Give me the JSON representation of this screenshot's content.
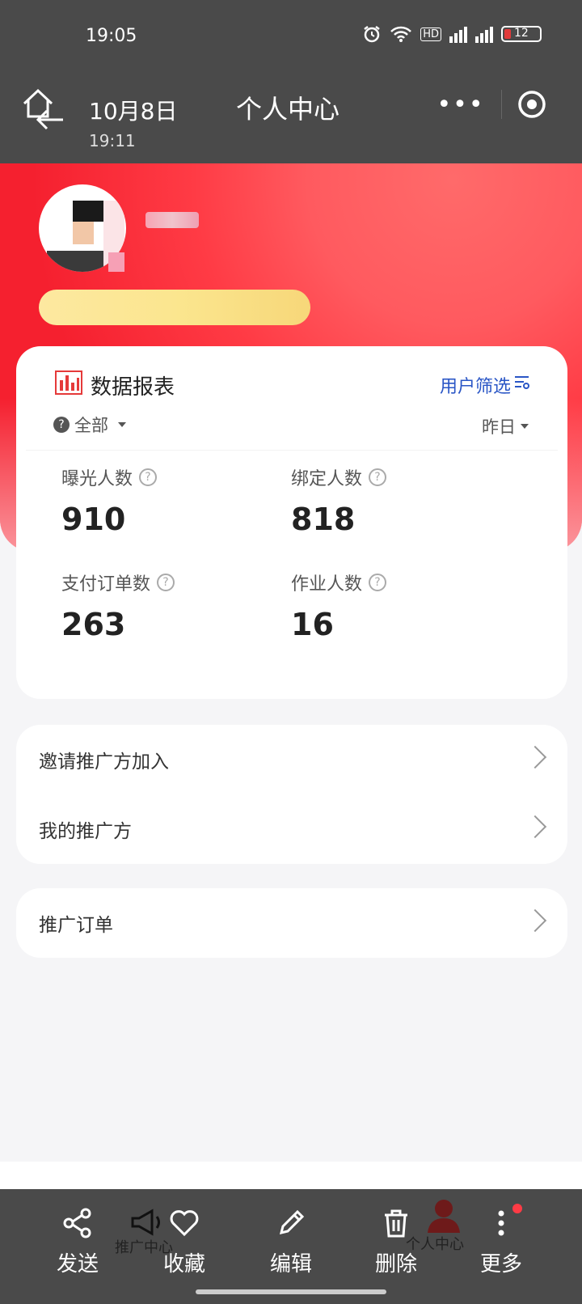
{
  "status_bar": {
    "time": "19:05",
    "network": "4G",
    "hd": "HD",
    "battery": "12"
  },
  "nav": {
    "date": "10月8日",
    "time": "19:11",
    "title": "个人中心",
    "more": "•••"
  },
  "data_card": {
    "title": "数据报表",
    "filter_label": "用户筛选",
    "scope": "全部",
    "period": "昨日",
    "stats": [
      {
        "label": "曝光人数",
        "value": "910"
      },
      {
        "label": "绑定人数",
        "value": "818"
      },
      {
        "label": "支付订单数",
        "value": "263"
      },
      {
        "label": "作业人数",
        "value": "16"
      }
    ]
  },
  "menu_group_1": [
    {
      "label": "邀请推广方加入"
    },
    {
      "label": "我的推广方"
    }
  ],
  "menu_group_2": [
    {
      "label": "推广订单"
    }
  ],
  "tabbar_ghost": {
    "left": "推广中心",
    "right": "个人中心"
  },
  "share_actions": [
    {
      "label": "发送",
      "icon": "share-icon"
    },
    {
      "label": "收藏",
      "icon": "heart-icon"
    },
    {
      "label": "编辑",
      "icon": "pencil-icon"
    },
    {
      "label": "删除",
      "icon": "trash-icon"
    },
    {
      "label": "更多",
      "icon": "more-vertical-icon"
    }
  ],
  "colors": {
    "brand_red": "#f5202f",
    "link_blue": "#2a56c6",
    "overlay": "#4a4a4a"
  }
}
